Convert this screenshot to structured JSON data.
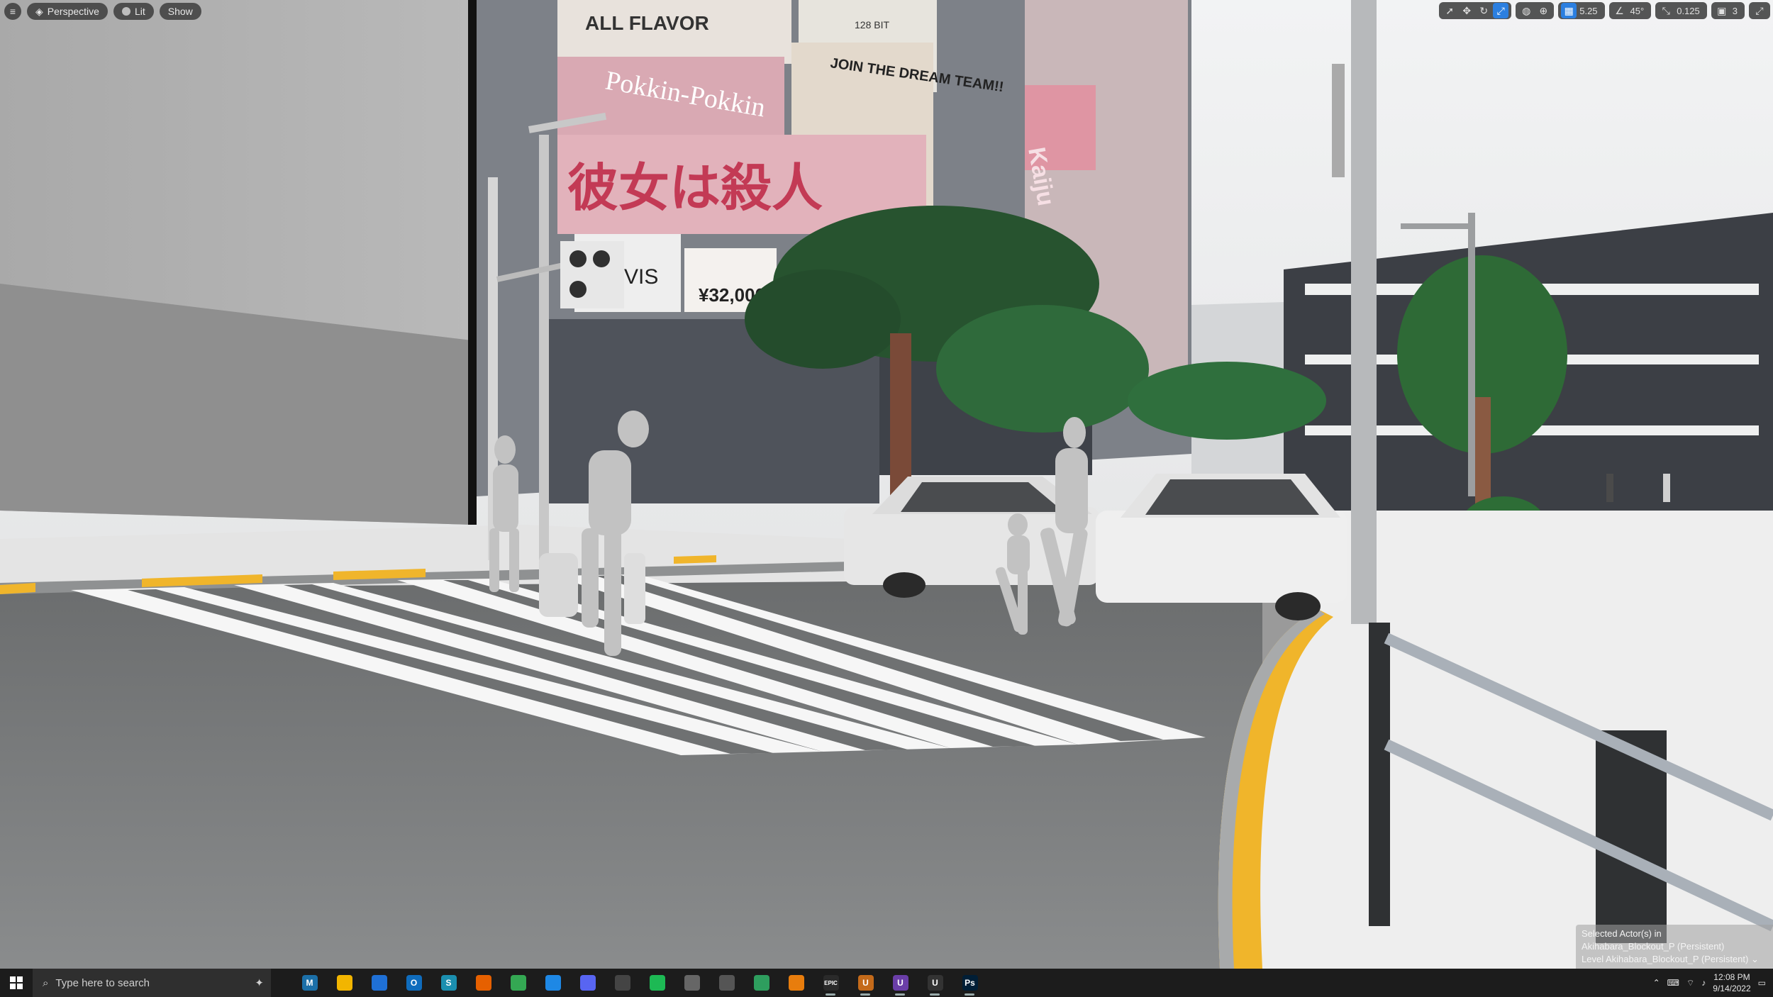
{
  "viewport": {
    "menu_icon": "hamburger-icon",
    "perspective_label": "Perspective",
    "lit_label": "Lit",
    "show_label": "Show",
    "grid_snap_value": "5.25",
    "rotation_snap_value": "45°",
    "scale_snap_value": "0.125",
    "camera_speed_value": "3"
  },
  "billboards": {
    "flavor": "ALL FLAVOR",
    "bit": "128 BIT",
    "dream_team": "JOIN THE DREAM TEAM!!",
    "pokkin": "Pokkin-Pokkin",
    "kanji": "彼女は殺人",
    "vis": "VIS",
    "price": "¥32,000",
    "kaiju": "Kaiju"
  },
  "selection_info": {
    "line1": "Selected Actor(s) in",
    "line2": "Akihabara_Blockout_P (Persistent)",
    "line3": "Level Akihabara_Blockout_P (Persistent)"
  },
  "taskbar": {
    "search_placeholder": "Type here to search",
    "time": "12:08 PM",
    "date": "9/14/2022",
    "apps": [
      {
        "name": "maya",
        "letter": "M",
        "color": "#1b6fa8"
      },
      {
        "name": "file-explorer",
        "letter": "",
        "color": "#f2b500"
      },
      {
        "name": "defender",
        "letter": "",
        "color": "#1f70d6"
      },
      {
        "name": "outlook",
        "letter": "O",
        "color": "#0f6cbd"
      },
      {
        "name": "substance",
        "letter": "S",
        "color": "#1b8fb0"
      },
      {
        "name": "firefox",
        "letter": "",
        "color": "#e66000"
      },
      {
        "name": "chrome",
        "letter": "",
        "color": "#34a853"
      },
      {
        "name": "photos",
        "letter": "",
        "color": "#1e88e5"
      },
      {
        "name": "discord",
        "letter": "",
        "color": "#5865f2"
      },
      {
        "name": "davinci",
        "letter": "",
        "color": "#444444"
      },
      {
        "name": "spotify",
        "letter": "",
        "color": "#1db954"
      },
      {
        "name": "steam",
        "letter": "",
        "color": "#666666"
      },
      {
        "name": "browser",
        "letter": "",
        "color": "#555555"
      },
      {
        "name": "tracker",
        "letter": "",
        "color": "#2e9e5e"
      },
      {
        "name": "blender",
        "letter": "",
        "color": "#e87d0d"
      },
      {
        "name": "epic-games",
        "letter": "EPIC",
        "color": "#2a2a2a"
      },
      {
        "name": "unreal-1",
        "letter": "U",
        "color": "#c46a1a"
      },
      {
        "name": "unreal-2",
        "letter": "U",
        "color": "#6a3ea8"
      },
      {
        "name": "unreal-3",
        "letter": "U",
        "color": "#333333"
      },
      {
        "name": "photoshop",
        "letter": "Ps",
        "color": "#001e36"
      }
    ]
  }
}
